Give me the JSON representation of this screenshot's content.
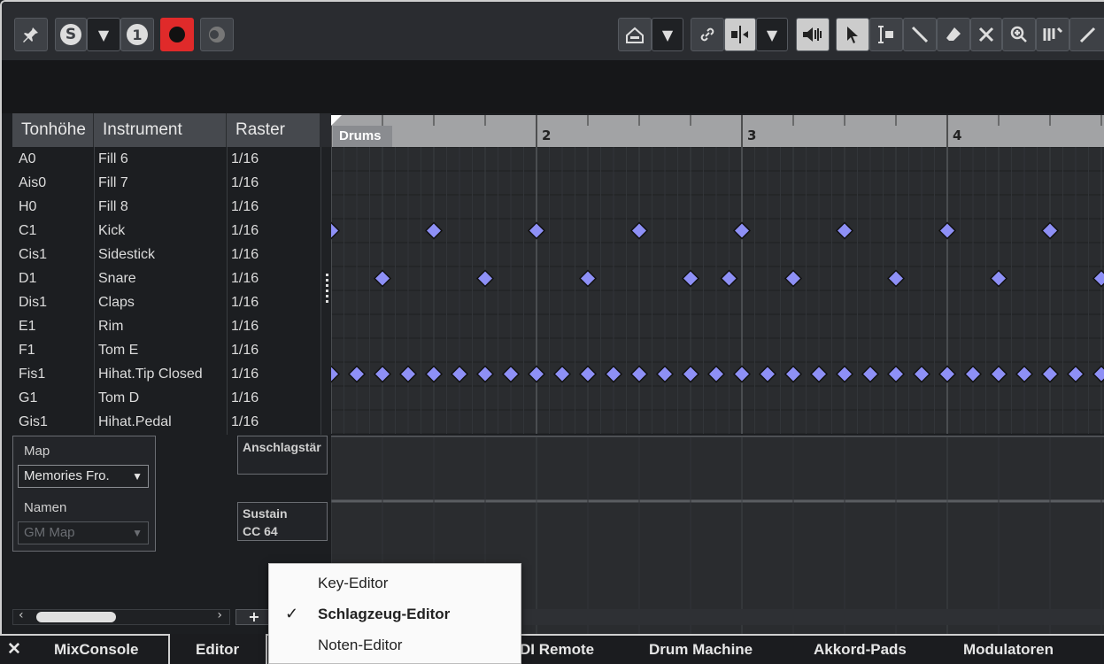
{
  "toolbar": {
    "solo_label": "S",
    "one_label": "1",
    "dropdown_glyph": "▼"
  },
  "columns": {
    "pitch": "Tonhöhe",
    "instrument": "Instrument",
    "quantize": "Raster"
  },
  "rows": [
    {
      "pitch": "A0",
      "instrument": "Fill 6",
      "quantize": "1/16"
    },
    {
      "pitch": "Ais0",
      "instrument": "Fill 7",
      "quantize": "1/16"
    },
    {
      "pitch": "H0",
      "instrument": "Fill 8",
      "quantize": "1/16"
    },
    {
      "pitch": "C1",
      "instrument": "Kick",
      "quantize": "1/16"
    },
    {
      "pitch": "Cis1",
      "instrument": "Sidestick",
      "quantize": "1/16"
    },
    {
      "pitch": "D1",
      "instrument": "Snare",
      "quantize": "1/16"
    },
    {
      "pitch": "Dis1",
      "instrument": "Claps",
      "quantize": "1/16"
    },
    {
      "pitch": "E1",
      "instrument": "Rim",
      "quantize": "1/16"
    },
    {
      "pitch": "F1",
      "instrument": "Tom E",
      "quantize": "1/16"
    },
    {
      "pitch": "Fis1",
      "instrument": "Hihat.Tip Closed",
      "quantize": "1/16"
    },
    {
      "pitch": "G1",
      "instrument": "Tom D",
      "quantize": "1/16"
    },
    {
      "pitch": "Gis1",
      "instrument": "Hihat.Pedal",
      "quantize": "1/16"
    }
  ],
  "ruler": {
    "bars": [
      "2",
      "3",
      "4"
    ],
    "part_name": "Drums"
  },
  "notes": {
    "kick": [
      1,
      1.5,
      2,
      2.5,
      3,
      3.5,
      4,
      4.5
    ],
    "snare": [
      1.25,
      1.75,
      2.25,
      2.75,
      2.9375,
      3.25,
      3.75,
      4.25,
      4.75
    ],
    "hihat": [
      1,
      1.125,
      1.25,
      1.375,
      1.5,
      1.625,
      1.75,
      1.875,
      2,
      2.125,
      2.25,
      2.375,
      2.5,
      2.625,
      2.75,
      2.875,
      3,
      3.125,
      3.25,
      3.375,
      3.5,
      3.625,
      3.75,
      3.875,
      4,
      4.125,
      4.25,
      4.375,
      4.5,
      4.625,
      4.75,
      4.875
    ]
  },
  "map_panel": {
    "map_label": "Map",
    "map_value": "Memories Fro.",
    "names_label": "Namen",
    "names_value": "GM Map"
  },
  "lanes": {
    "velocity": "Anschlagstär",
    "sustain_1": "Sustain",
    "sustain_2": "CC 64"
  },
  "bottom_tabs": {
    "close": "✕",
    "mixconsole": "MixConsole",
    "editor": "Editor",
    "midi_remote": "DI Remote",
    "drum_machine": "Drum Machine",
    "chord_pads": "Akkord-Pads",
    "modulators": "Modulatoren"
  },
  "popup": {
    "items": [
      "Key-Editor",
      "Schlagzeug-Editor",
      "Noten-Editor"
    ],
    "check": "✓"
  },
  "colors": {
    "note": "#8e90f6",
    "record": "#e02a2a"
  }
}
